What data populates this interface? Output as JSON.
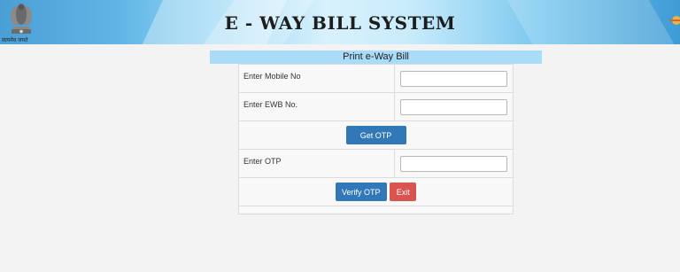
{
  "header": {
    "title": "E - WAY BILL SYSTEM",
    "emblem_text": "सत्यमेव जयते",
    "emblem_icon": "national-emblem-icon",
    "right_icon": "flag-icon"
  },
  "panel": {
    "title": "Print e-Way Bill"
  },
  "form": {
    "mobile_label": "Enter Mobile No",
    "mobile_value": "",
    "ewb_label": "Enter EWB No.",
    "ewb_value": "",
    "get_otp_label": "Get OTP",
    "otp_label": "Enter OTP",
    "otp_value": "",
    "verify_otp_label": "Verify OTP",
    "exit_label": "Exit"
  },
  "colors": {
    "primary_button": "#3178b8",
    "danger_button": "#d9534f",
    "panel_header": "#a8dcf8"
  }
}
